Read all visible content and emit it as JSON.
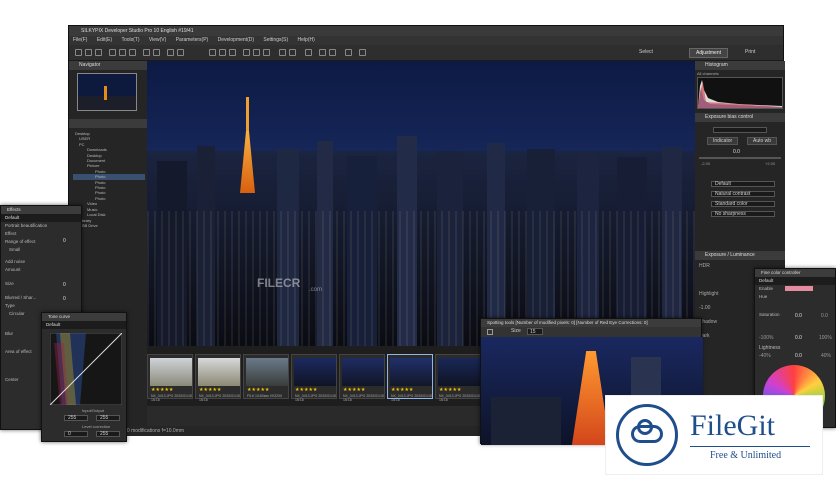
{
  "app": {
    "title": "SILKYPIX Developer Studio Pro 10 English  #19/41",
    "menu": [
      "File(F)",
      "Edit(E)",
      "Tools(T)",
      "View(V)",
      "Parameters(P)",
      "Development(D)",
      "Settings(S)",
      "Help(H)"
    ],
    "toolbar_right": {
      "select_label": "Select",
      "adjustment_label": "Adjustment",
      "print_label": "Print"
    }
  },
  "left": {
    "navigator_title": "Navigator",
    "folder_tree": [
      "Desktop",
      "USER",
      "PC",
      "Downloads",
      "Desktop",
      "Document",
      "Picture",
      "Photo",
      "Photo",
      "Photo",
      "Photo",
      "Photo",
      "Photo",
      "Video",
      "Music",
      "Local Disk",
      "Library",
      "USB Drive"
    ]
  },
  "effects": {
    "title": "Effects",
    "preset": "Default",
    "portrait_label": "Portrait beautification",
    "effect_label": "Effect",
    "effect_value": "0",
    "range_label": "Range of effect",
    "range_value": "Small",
    "add_noise_label": "Add noise",
    "amount_label": "Amount",
    "amount_value": "0",
    "size_label": "Size",
    "size_value": "0",
    "blurred_label": "Blurred / Shar...",
    "type_label": "Type",
    "type_value": "Circular",
    "blur_label": "Blur",
    "area_label": "Area of effect",
    "center_label": "Center"
  },
  "tone_curve": {
    "title": "Tone curve",
    "preset": "Default",
    "input_label": "Input/Output",
    "in_value": "255",
    "out_value": "255",
    "level_label": "Level correction",
    "level_low": "0",
    "level_high": "255"
  },
  "right": {
    "histogram_title": "Histogram",
    "channels_label": "All channels",
    "exposure_title": "Exposure bias control",
    "value_zero": "0.0",
    "value_neg": "-2.00",
    "value_pos": "+2.00",
    "indicator_label": "Indicator",
    "auto_wb_label": "Auto wb",
    "presets": [
      "Default",
      "Natural contrast",
      "Standard color",
      "No sharpness"
    ],
    "exposure2_title": "Exposure / Luminance",
    "hdr_label": "HDR",
    "highlight_label": "Highlight",
    "shadow_label": "Shadow",
    "dark_label": "Dark",
    "minus_one": "-1.00"
  },
  "fine_color": {
    "title": "Fine color controller",
    "preset": "Default",
    "enable_label": "Enable",
    "hue_label": "Hue",
    "hue_value": "0.0",
    "hue_deg": "0.0",
    "saturation_label": "Saturation",
    "sat_low": "-100%",
    "sat_value": "0.0",
    "sat_high": "100%",
    "lightness_label": "Lightness",
    "light_low": "-40%",
    "light_value": "0.0",
    "light_high": "40%"
  },
  "spotting": {
    "title": "Spotting tools [Number of modified pixels: 0]  [Number of Red Eye Corrections: 0]",
    "size_label": "Size",
    "size_value": "15"
  },
  "thumbs": {
    "stars": "★★★★★",
    "meta1": "NX_0413.JPG  2020/01/15 18:18",
    "meta2": "F5.6 1/160sec ISO200"
  },
  "viewer_watermark": "FILECR",
  "viewer_watermark_sub": ".com",
  "status_text": "ISO 4.0  1/0.60sec.  1.00 0  modifications  f=10.0mm",
  "logo": {
    "brand": "FileGit",
    "tagline": "Free & Unlimited"
  }
}
